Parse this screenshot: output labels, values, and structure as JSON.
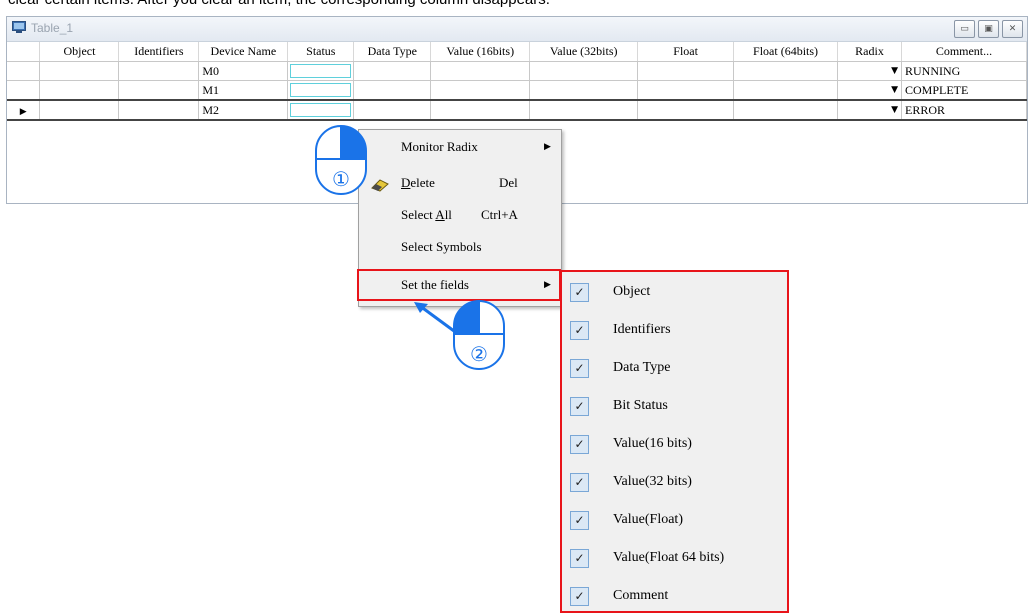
{
  "caption": "clear certain items. After you clear an item, the corresponding column disappears.",
  "window": {
    "title": "Table_1",
    "buttons": [
      "minimize-button",
      "restore-button",
      "close-button"
    ]
  },
  "table": {
    "columns": [
      "Object",
      "Identifiers",
      "Device Name",
      "Status",
      "Data Type",
      "Value (16bits)",
      "Value (32bits)",
      "Float",
      "Float (64bits)",
      "Radix",
      "Comment..."
    ],
    "rows": [
      {
        "device": "M0",
        "comment": "RUNNING"
      },
      {
        "device": "M1",
        "comment": "COMPLETE"
      },
      {
        "device": "M2",
        "comment": "ERROR"
      }
    ],
    "current_row_index": 2
  },
  "context_menu": {
    "monitor_radix": "Monitor Radix",
    "delete": {
      "label": "Delete",
      "shortcut": "Del"
    },
    "select_all": {
      "label": "Select All",
      "shortcut": "Ctrl+A"
    },
    "select_symbols": "Select Symbols",
    "set_fields": "Set the fields"
  },
  "submenu": {
    "items": [
      {
        "label": "Object",
        "checked": true
      },
      {
        "label": "Identifiers",
        "checked": true
      },
      {
        "label": "Data Type",
        "checked": true
      },
      {
        "label": "Bit Status",
        "checked": true
      },
      {
        "label": "Value(16 bits)",
        "checked": true
      },
      {
        "label": "Value(32 bits)",
        "checked": true
      },
      {
        "label": "Value(Float)",
        "checked": true
      },
      {
        "label": "Value(Float 64 bits)",
        "checked": true
      },
      {
        "label": "Comment",
        "checked": true
      }
    ]
  },
  "callouts": {
    "step1": "①",
    "step2": "②"
  },
  "colors": {
    "highlight": "#e8141a",
    "callout_blue": "#1a73e8",
    "checkbox_bg": "#dbe8f5"
  }
}
